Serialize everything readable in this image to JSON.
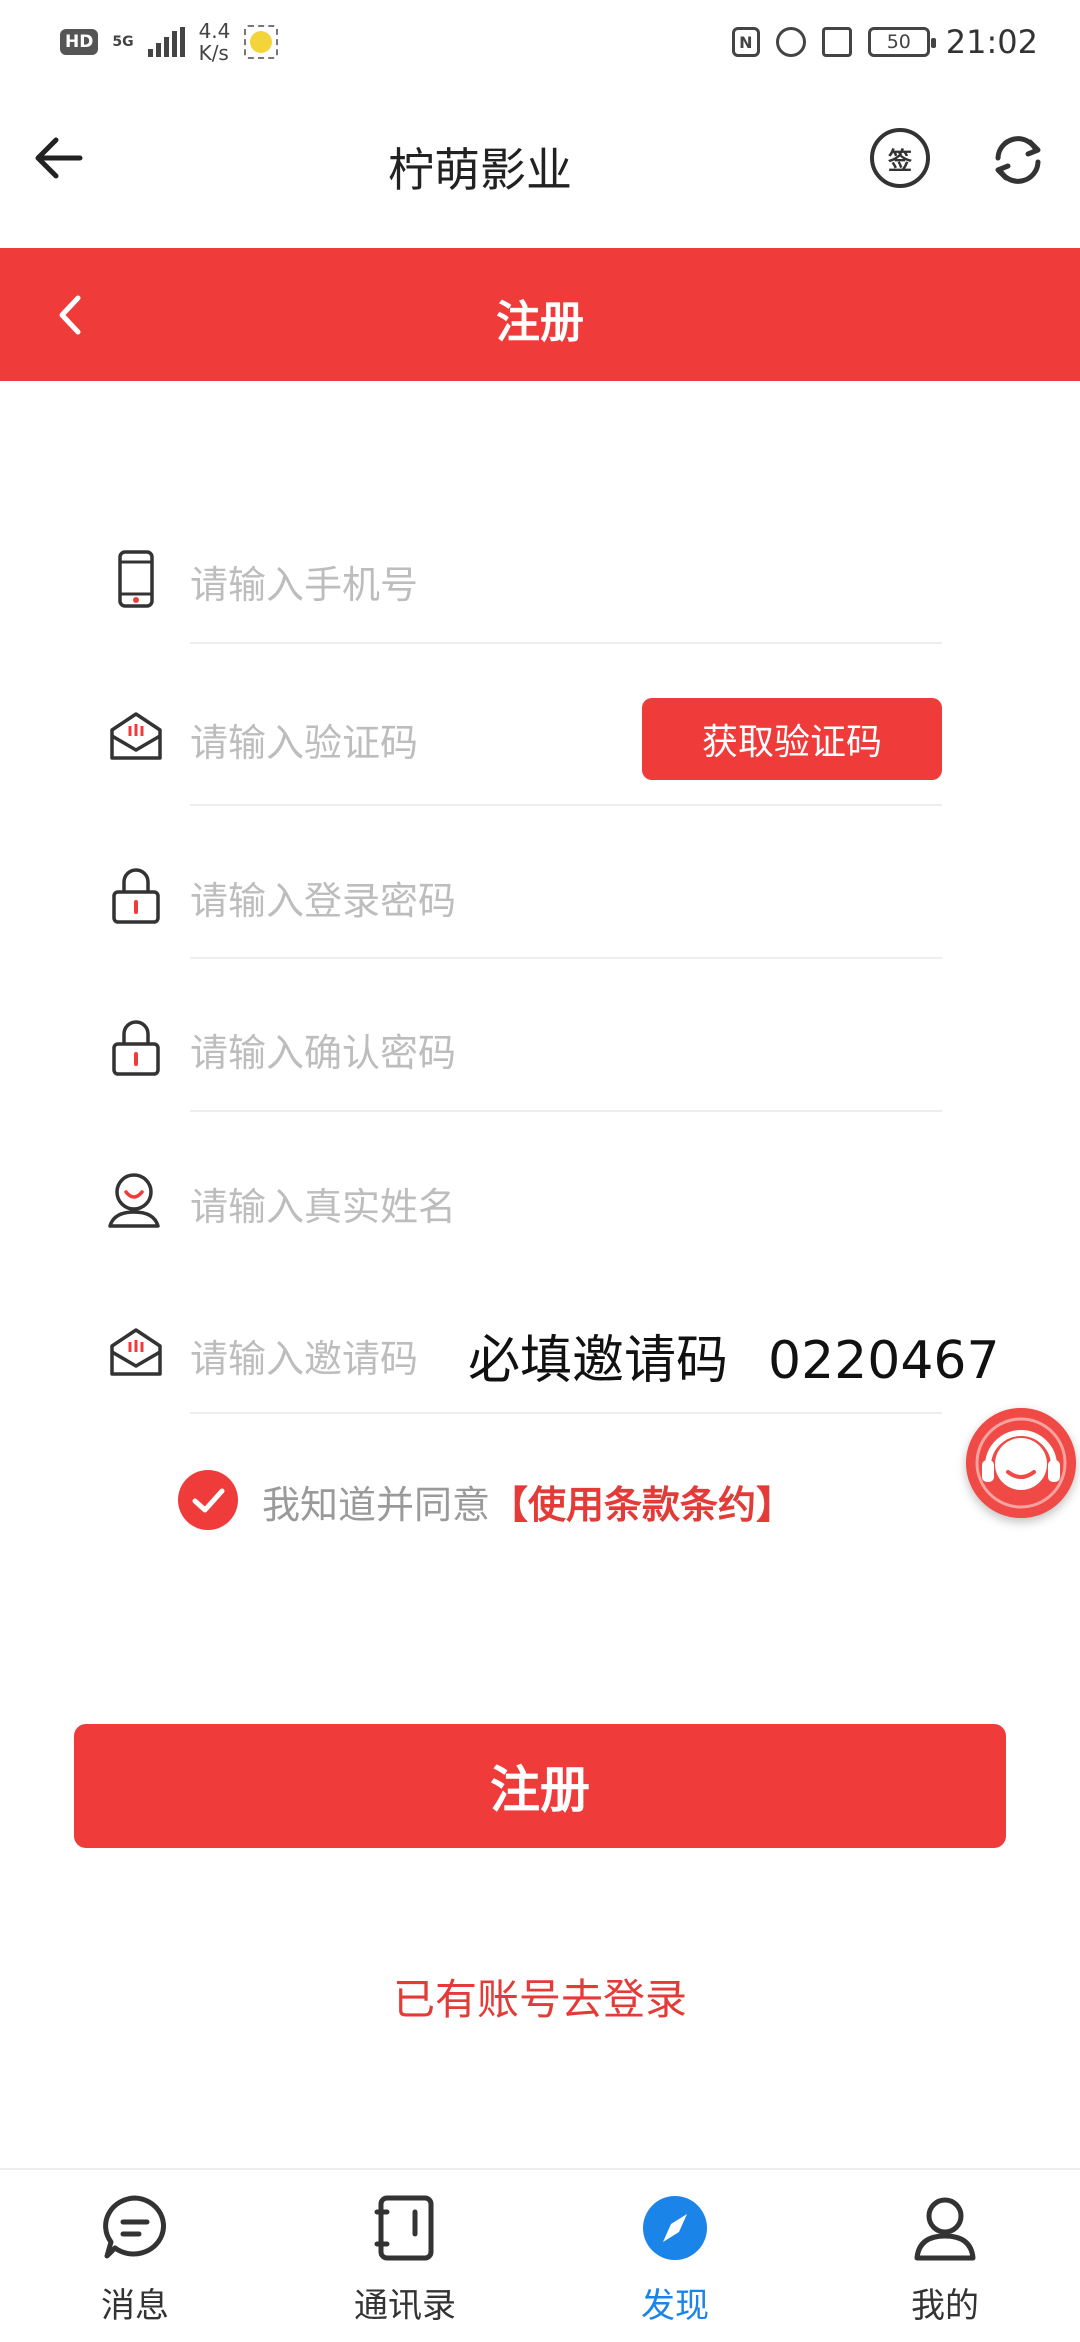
{
  "status_bar": {
    "hd": "HD",
    "network": "5G",
    "speed_value": "4.4",
    "speed_unit": "K/s",
    "battery": "50",
    "time": "21:02"
  },
  "header": {
    "title": "柠萌影业",
    "sign_glyph": "签"
  },
  "register_bar": {
    "title": "注册"
  },
  "form": {
    "phone_placeholder": "请输入手机号",
    "code_placeholder": "请输入验证码",
    "get_code_label": "获取验证码",
    "password_placeholder": "请输入登录密码",
    "confirm_placeholder": "请输入确认密码",
    "name_placeholder": "请输入真实姓名",
    "invite_placeholder": "请输入邀请码",
    "invite_note": "必填邀请码",
    "invite_code": "0220467"
  },
  "agreement": {
    "text": "我知道并同意",
    "terms": "【使用条款条约】",
    "checked": true
  },
  "submit_label": "注册",
  "login_link": "已有账号去登录",
  "bottom_nav": {
    "items": [
      {
        "label": "消息",
        "icon": "message-icon",
        "active": false
      },
      {
        "label": "通讯录",
        "icon": "contacts-icon",
        "active": false
      },
      {
        "label": "发现",
        "icon": "compass-icon",
        "active": true
      },
      {
        "label": "我的",
        "icon": "profile-icon",
        "active": false
      }
    ]
  },
  "colors": {
    "accent": "#ef3b3a",
    "active_nav": "#1a84e8",
    "placeholder": "#bdbdbd"
  }
}
